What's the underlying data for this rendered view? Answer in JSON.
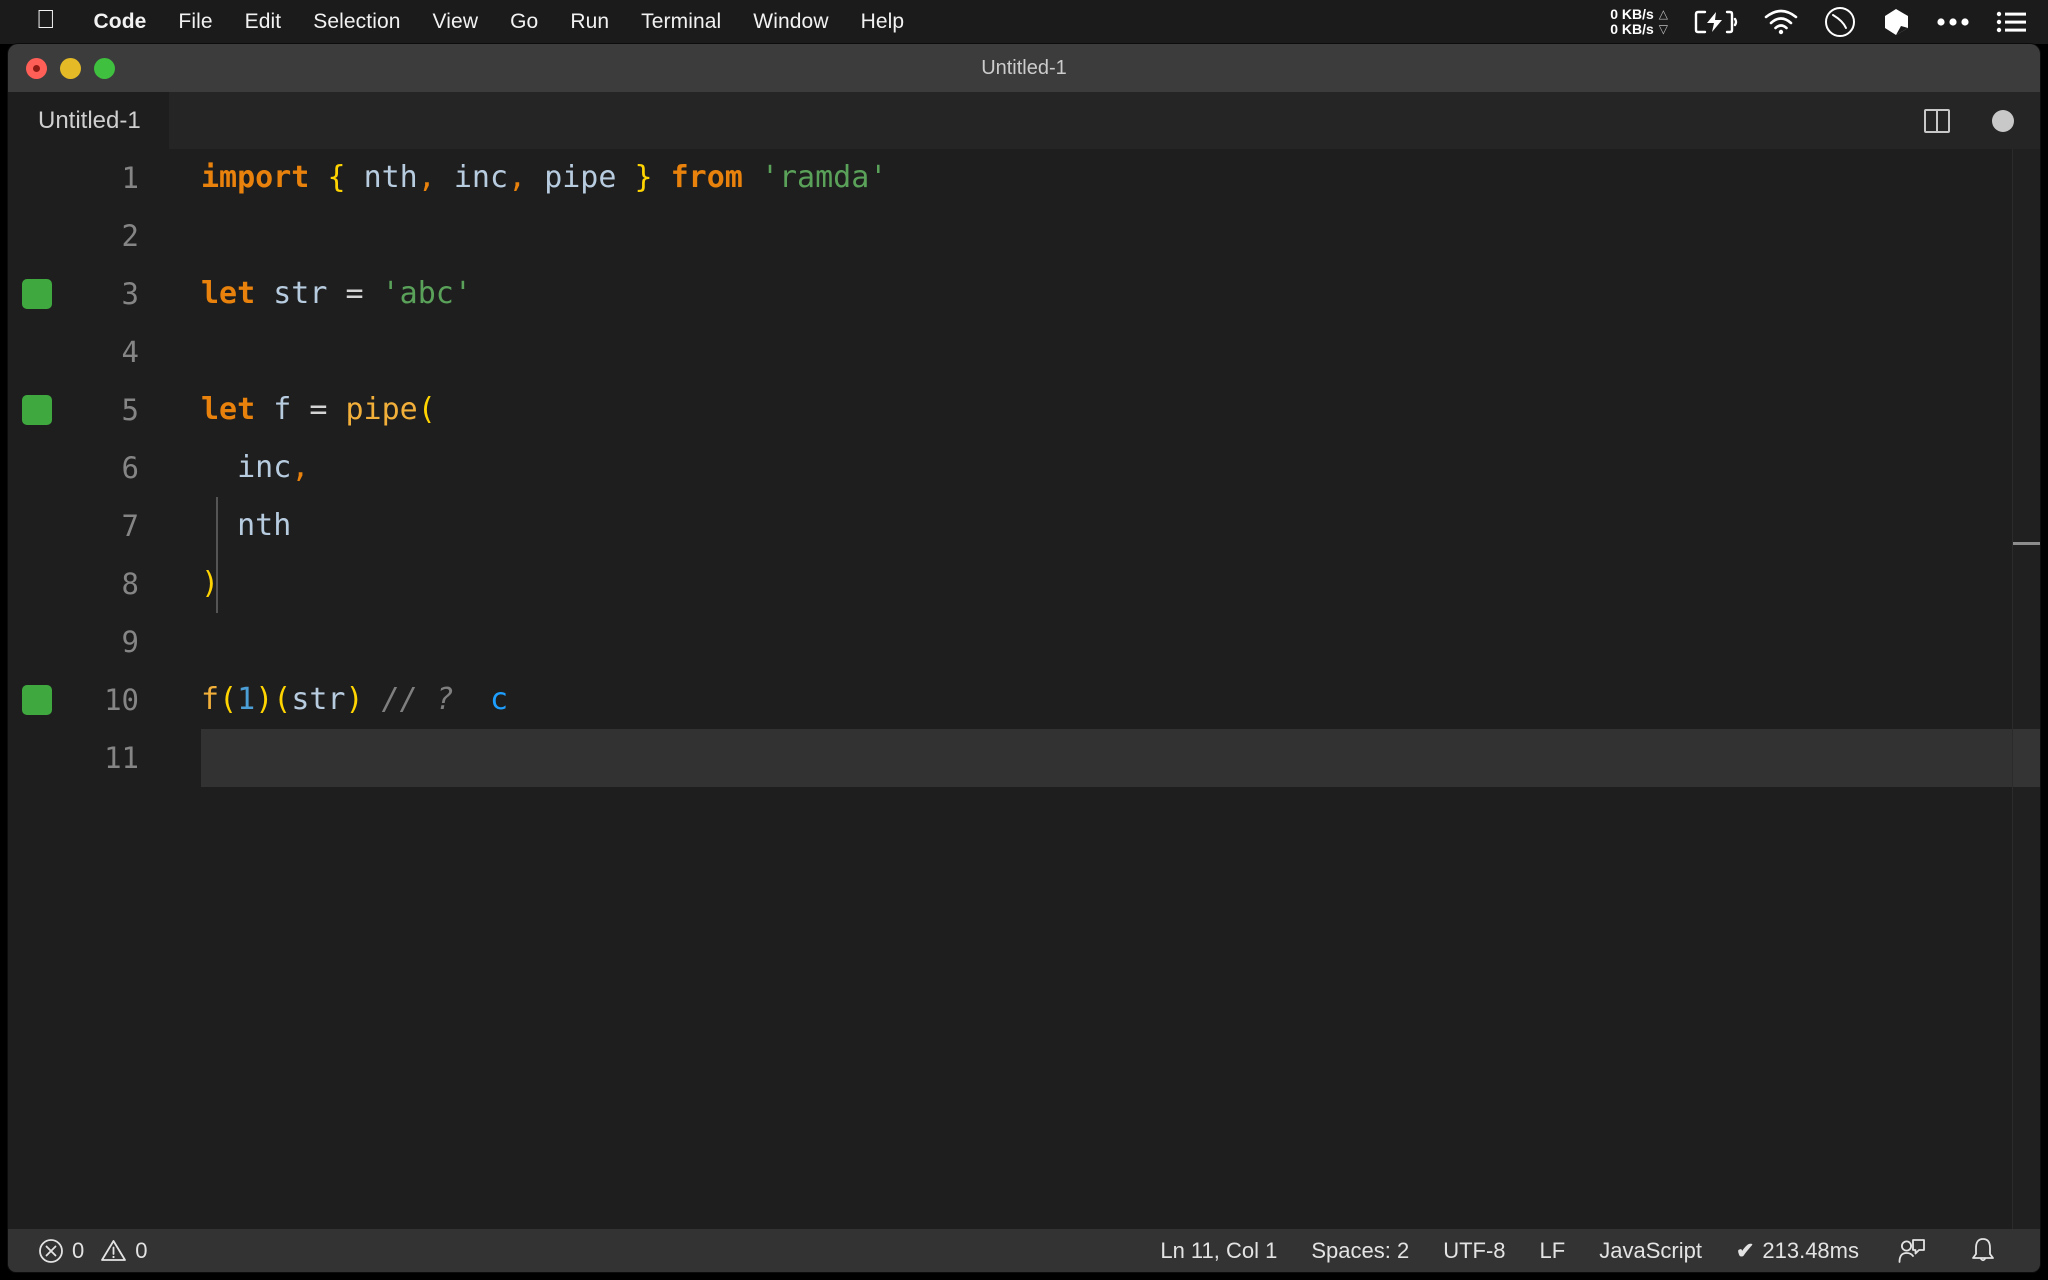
{
  "menubar": {
    "apple_icon": "apple-logo-icon",
    "items": [
      "Code",
      "File",
      "Edit",
      "Selection",
      "View",
      "Go",
      "Run",
      "Terminal",
      "Window",
      "Help"
    ],
    "tray": {
      "network_up": "0 KB/s",
      "network_down": "0 KB/s",
      "up_arrow": "△",
      "down_arrow": "▽",
      "icons": [
        "battery-charging-icon",
        "wifi-icon",
        "clock-icon",
        "dropbox-icon",
        "control-center-icon",
        "list-menu-icon"
      ]
    }
  },
  "window": {
    "title": "Untitled-1",
    "traffic_lights": [
      "close-button",
      "minimize-button",
      "maximize-button"
    ]
  },
  "tabbar": {
    "tabs": [
      {
        "label": "Untitled-1",
        "active": true,
        "dirty": true
      }
    ],
    "actions": [
      "split-editor-button",
      "unsaved-changes-indicator"
    ]
  },
  "editor": {
    "language": "JavaScript",
    "lines": [
      {
        "number": "1",
        "marked": false,
        "current": false,
        "tokens": [
          {
            "t": "import",
            "c": "kw"
          },
          {
            "t": " ",
            "c": "op"
          },
          {
            "t": "{",
            "c": "brc"
          },
          {
            "t": " ",
            "c": "op"
          },
          {
            "t": "nth",
            "c": "id"
          },
          {
            "t": ",",
            "c": "pun"
          },
          {
            "t": " ",
            "c": "op"
          },
          {
            "t": "inc",
            "c": "id"
          },
          {
            "t": ",",
            "c": "pun"
          },
          {
            "t": " ",
            "c": "op"
          },
          {
            "t": "pipe",
            "c": "id"
          },
          {
            "t": " ",
            "c": "op"
          },
          {
            "t": "}",
            "c": "brc"
          },
          {
            "t": " ",
            "c": "op"
          },
          {
            "t": "from",
            "c": "kw"
          },
          {
            "t": " ",
            "c": "op"
          },
          {
            "t": "'ramda'",
            "c": "str"
          }
        ]
      },
      {
        "number": "2",
        "marked": false,
        "current": false,
        "tokens": []
      },
      {
        "number": "3",
        "marked": true,
        "current": false,
        "tokens": [
          {
            "t": "let",
            "c": "kw"
          },
          {
            "t": " ",
            "c": "op"
          },
          {
            "t": "str",
            "c": "id"
          },
          {
            "t": " ",
            "c": "op"
          },
          {
            "t": "=",
            "c": "op"
          },
          {
            "t": " ",
            "c": "op"
          },
          {
            "t": "'abc'",
            "c": "str"
          }
        ]
      },
      {
        "number": "4",
        "marked": false,
        "current": false,
        "tokens": []
      },
      {
        "number": "5",
        "marked": true,
        "current": false,
        "tokens": [
          {
            "t": "let",
            "c": "kw"
          },
          {
            "t": " ",
            "c": "op"
          },
          {
            "t": "f",
            "c": "id"
          },
          {
            "t": " ",
            "c": "op"
          },
          {
            "t": "=",
            "c": "op"
          },
          {
            "t": " ",
            "c": "op"
          },
          {
            "t": "pipe",
            "c": "fn"
          },
          {
            "t": "(",
            "c": "brc"
          }
        ]
      },
      {
        "number": "6",
        "marked": false,
        "current": false,
        "tokens": [
          {
            "t": "  inc",
            "c": "id"
          },
          {
            "t": ",",
            "c": "pun"
          }
        ]
      },
      {
        "number": "7",
        "marked": false,
        "current": false,
        "tokens": [
          {
            "t": "  nth",
            "c": "id"
          }
        ]
      },
      {
        "number": "8",
        "marked": false,
        "current": false,
        "tokens": [
          {
            "t": ")",
            "c": "brc"
          }
        ]
      },
      {
        "number": "9",
        "marked": false,
        "current": false,
        "tokens": []
      },
      {
        "number": "10",
        "marked": true,
        "current": false,
        "tokens": [
          {
            "t": "f",
            "c": "fn"
          },
          {
            "t": "(",
            "c": "brc"
          },
          {
            "t": "1",
            "c": "num2"
          },
          {
            "t": ")",
            "c": "brc"
          },
          {
            "t": "(",
            "c": "brc"
          },
          {
            "t": "str",
            "c": "id"
          },
          {
            "t": ")",
            "c": "brc"
          },
          {
            "t": " ",
            "c": "op"
          },
          {
            "t": "// ?",
            "c": "cmt"
          },
          {
            "t": "  ",
            "c": "op"
          },
          {
            "t": "c",
            "c": "qval"
          }
        ]
      },
      {
        "number": "11",
        "marked": false,
        "current": true,
        "tokens": []
      }
    ]
  },
  "statusbar": {
    "errors_icon": "error-circle-icon",
    "errors": "0",
    "warnings_icon": "warning-triangle-icon",
    "warnings": "0",
    "position": "Ln 11, Col 1",
    "indentation": "Spaces: 2",
    "encoding": "UTF-8",
    "eol": "LF",
    "language": "JavaScript",
    "quokka_check": "✔",
    "quokka_time": "213.48ms",
    "feedback_icon": "feedback-person-icon",
    "bell_icon": "notification-bell-icon"
  },
  "colors": {
    "background": "#1e1e1e",
    "titlebar": "#3c3c3c",
    "tabbar": "#252526",
    "statusbar": "#333333",
    "marker_green": "#3fa93f",
    "keyword_orange": "#e8820c",
    "bracket_yellow": "#ffd400",
    "string_green": "#5aa15a",
    "number_blue": "#4b9fd6",
    "quokka_blue": "#1e9fff"
  }
}
